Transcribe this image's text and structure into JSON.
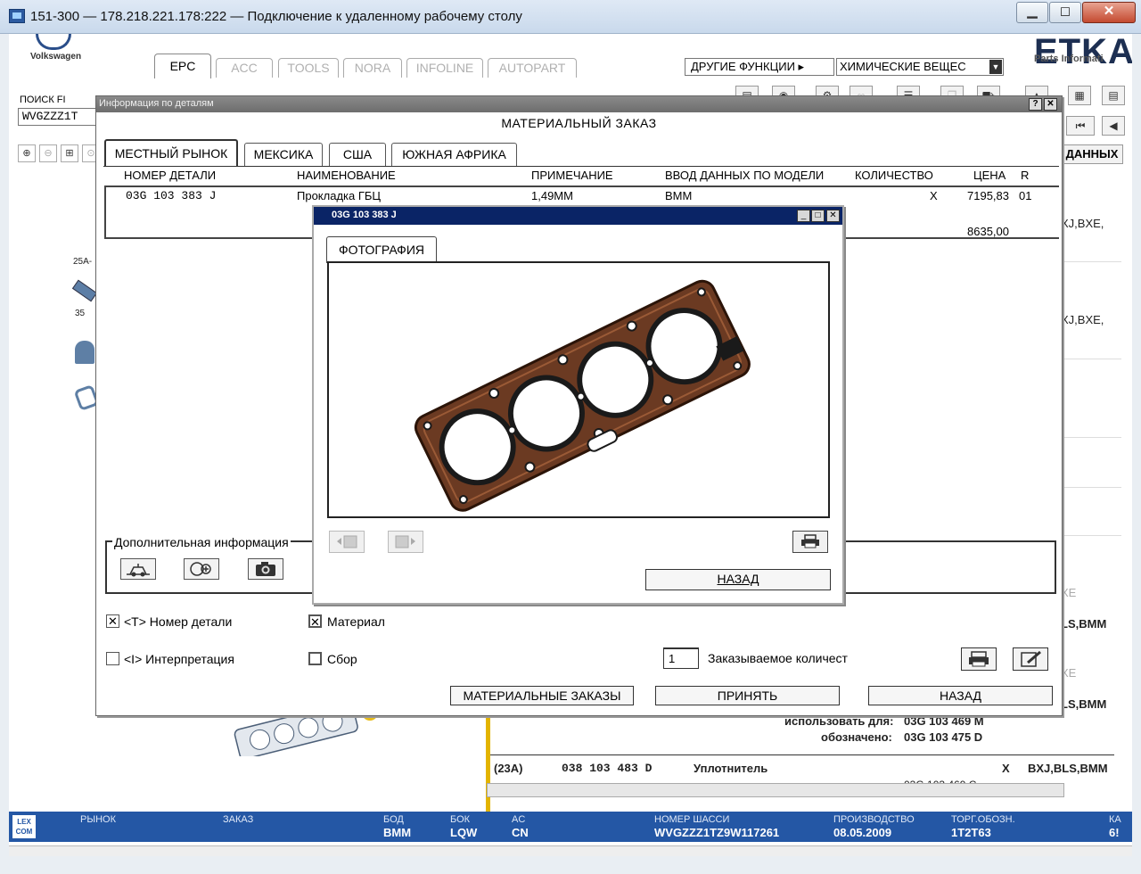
{
  "window": {
    "title": "151-300 — 178.218.221.178:222 — Подключение к удаленному рабочему столу",
    "min": "▁",
    "max": "◻",
    "close": "✕"
  },
  "header": {
    "brand": "Volkswagen",
    "logo": "ETKA",
    "logo_sub": "Parts Informati",
    "tabs": [
      {
        "label": "EPC",
        "active": true
      },
      {
        "label": "ACC"
      },
      {
        "label": "TOOLS"
      },
      {
        "label": "NORA"
      },
      {
        "label": "INFOLINE"
      },
      {
        "label": "AUTOPART"
      }
    ],
    "other_functions": "ДРУГИЕ ФУНКЦИИ ▸",
    "select_value": "ХИМИЧЕСКИЕ ВЕЩЕС"
  },
  "search": {
    "label": "ПОИСК FI",
    "value": "WVGZZZ1T"
  },
  "background": {
    "data_button": "ДАННЫХ",
    "rows": [
      {
        "text": "XJ,BXE,"
      },
      {
        "text": "XJ,BXE,"
      },
      {
        "text": "XE"
      },
      {
        "text": "LS,BMM"
      },
      {
        "text": "XE"
      },
      {
        "text": "LS,BMM"
      }
    ],
    "use_for_label": "использовать для:",
    "use_for_value": "03G 103 469 M",
    "designated_label": "обозначено:",
    "designated_value": "03G 103 475 D",
    "row_ref": "(23A)",
    "row_part": "038 103 483 D",
    "row_name": "Уплотнитель",
    "row_x": "X",
    "row_codes": "BXJ,BLS,BMM",
    "row_cut": "03G 103 469 C",
    "left_label_1": "25A-",
    "left_label_2": "35"
  },
  "status": {
    "lexcom": "LEX COM",
    "fields": [
      {
        "label": "РЫНОК",
        "value": ""
      },
      {
        "label": "ЗАКАЗ",
        "value": ""
      },
      {
        "label": "БОД",
        "value": "BMM"
      },
      {
        "label": "БОК",
        "value": "LQW"
      },
      {
        "label": "AC",
        "value": "CN"
      },
      {
        "label": "НОМЕР ШАССИ",
        "value": "WVGZZZ1TZ9W117261"
      },
      {
        "label": "ПРОИЗВОДСТВО",
        "value": "08.05.2009"
      },
      {
        "label": "ТОРГ.ОБОЗН.",
        "value": "1T2T63"
      },
      {
        "label": "КА",
        "value": "6!"
      }
    ]
  },
  "dialog_info": {
    "title": "Информация по деталям",
    "help": "?",
    "close": "✕",
    "heading": "МАТЕРИАЛЬНЫЙ ЗАКАЗ",
    "tabs": [
      {
        "label": "МЕСТНЫЙ РЫНОК",
        "active": true
      },
      {
        "label": "МЕКСИКА"
      },
      {
        "label": "США"
      },
      {
        "label": "ЮЖНАЯ АФРИКА"
      }
    ],
    "columns": [
      "НОМЕР ДЕТАЛИ",
      "НАИМЕНОВАНИЕ",
      "ПРИМЕЧАНИЕ",
      "ВВОД ДАННЫХ ПО МОДЕЛИ",
      "КОЛИЧЕСТВО",
      "ЦЕНА",
      "R"
    ],
    "row": {
      "part_number": "03G 103 383 J",
      "name": "Прокладка ГБЦ",
      "note": "1,49MM",
      "model": "BMM",
      "qty": "X",
      "price": "7195,83",
      "r": "01",
      "price2": "8635,00"
    },
    "extra_info_title": "Дополнительная информация",
    "checks": [
      {
        "label": "<T> Номер детали",
        "checked": true
      },
      {
        "label": "Материал",
        "checked": true
      },
      {
        "label": "<I> Интерпретация",
        "checked": false
      },
      {
        "label": "Сбор",
        "checked": false
      }
    ],
    "order_qty_value": "1",
    "order_qty_label": "Заказываемое количест",
    "buttons": {
      "material_orders": "МАТЕРИАЛЬНЫЕ ЗАКАЗЫ",
      "accept": "ПРИНЯТЬ",
      "back": "НАЗАД"
    }
  },
  "dialog_photo": {
    "title": "03G 103 383 J",
    "tab": "ФОТОГРАФИЯ",
    "back": "НАЗАД",
    "min": "_",
    "max": "□",
    "close": "✕"
  }
}
